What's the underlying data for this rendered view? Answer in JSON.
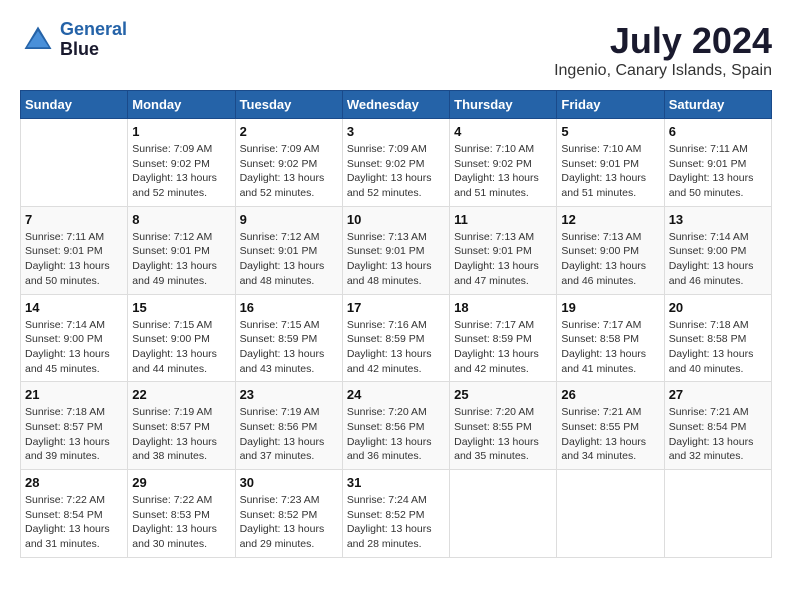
{
  "header": {
    "logo_line1": "General",
    "logo_line2": "Blue",
    "month_year": "July 2024",
    "location": "Ingenio, Canary Islands, Spain"
  },
  "columns": [
    "Sunday",
    "Monday",
    "Tuesday",
    "Wednesday",
    "Thursday",
    "Friday",
    "Saturday"
  ],
  "weeks": [
    [
      {
        "day": "",
        "info": ""
      },
      {
        "day": "1",
        "info": "Sunrise: 7:09 AM\nSunset: 9:02 PM\nDaylight: 13 hours\nand 52 minutes."
      },
      {
        "day": "2",
        "info": "Sunrise: 7:09 AM\nSunset: 9:02 PM\nDaylight: 13 hours\nand 52 minutes."
      },
      {
        "day": "3",
        "info": "Sunrise: 7:09 AM\nSunset: 9:02 PM\nDaylight: 13 hours\nand 52 minutes."
      },
      {
        "day": "4",
        "info": "Sunrise: 7:10 AM\nSunset: 9:02 PM\nDaylight: 13 hours\nand 51 minutes."
      },
      {
        "day": "5",
        "info": "Sunrise: 7:10 AM\nSunset: 9:01 PM\nDaylight: 13 hours\nand 51 minutes."
      },
      {
        "day": "6",
        "info": "Sunrise: 7:11 AM\nSunset: 9:01 PM\nDaylight: 13 hours\nand 50 minutes."
      }
    ],
    [
      {
        "day": "7",
        "info": "Sunrise: 7:11 AM\nSunset: 9:01 PM\nDaylight: 13 hours\nand 50 minutes."
      },
      {
        "day": "8",
        "info": "Sunrise: 7:12 AM\nSunset: 9:01 PM\nDaylight: 13 hours\nand 49 minutes."
      },
      {
        "day": "9",
        "info": "Sunrise: 7:12 AM\nSunset: 9:01 PM\nDaylight: 13 hours\nand 48 minutes."
      },
      {
        "day": "10",
        "info": "Sunrise: 7:13 AM\nSunset: 9:01 PM\nDaylight: 13 hours\nand 48 minutes."
      },
      {
        "day": "11",
        "info": "Sunrise: 7:13 AM\nSunset: 9:01 PM\nDaylight: 13 hours\nand 47 minutes."
      },
      {
        "day": "12",
        "info": "Sunrise: 7:13 AM\nSunset: 9:00 PM\nDaylight: 13 hours\nand 46 minutes."
      },
      {
        "day": "13",
        "info": "Sunrise: 7:14 AM\nSunset: 9:00 PM\nDaylight: 13 hours\nand 46 minutes."
      }
    ],
    [
      {
        "day": "14",
        "info": "Sunrise: 7:14 AM\nSunset: 9:00 PM\nDaylight: 13 hours\nand 45 minutes."
      },
      {
        "day": "15",
        "info": "Sunrise: 7:15 AM\nSunset: 9:00 PM\nDaylight: 13 hours\nand 44 minutes."
      },
      {
        "day": "16",
        "info": "Sunrise: 7:15 AM\nSunset: 8:59 PM\nDaylight: 13 hours\nand 43 minutes."
      },
      {
        "day": "17",
        "info": "Sunrise: 7:16 AM\nSunset: 8:59 PM\nDaylight: 13 hours\nand 42 minutes."
      },
      {
        "day": "18",
        "info": "Sunrise: 7:17 AM\nSunset: 8:59 PM\nDaylight: 13 hours\nand 42 minutes."
      },
      {
        "day": "19",
        "info": "Sunrise: 7:17 AM\nSunset: 8:58 PM\nDaylight: 13 hours\nand 41 minutes."
      },
      {
        "day": "20",
        "info": "Sunrise: 7:18 AM\nSunset: 8:58 PM\nDaylight: 13 hours\nand 40 minutes."
      }
    ],
    [
      {
        "day": "21",
        "info": "Sunrise: 7:18 AM\nSunset: 8:57 PM\nDaylight: 13 hours\nand 39 minutes."
      },
      {
        "day": "22",
        "info": "Sunrise: 7:19 AM\nSunset: 8:57 PM\nDaylight: 13 hours\nand 38 minutes."
      },
      {
        "day": "23",
        "info": "Sunrise: 7:19 AM\nSunset: 8:56 PM\nDaylight: 13 hours\nand 37 minutes."
      },
      {
        "day": "24",
        "info": "Sunrise: 7:20 AM\nSunset: 8:56 PM\nDaylight: 13 hours\nand 36 minutes."
      },
      {
        "day": "25",
        "info": "Sunrise: 7:20 AM\nSunset: 8:55 PM\nDaylight: 13 hours\nand 35 minutes."
      },
      {
        "day": "26",
        "info": "Sunrise: 7:21 AM\nSunset: 8:55 PM\nDaylight: 13 hours\nand 34 minutes."
      },
      {
        "day": "27",
        "info": "Sunrise: 7:21 AM\nSunset: 8:54 PM\nDaylight: 13 hours\nand 32 minutes."
      }
    ],
    [
      {
        "day": "28",
        "info": "Sunrise: 7:22 AM\nSunset: 8:54 PM\nDaylight: 13 hours\nand 31 minutes."
      },
      {
        "day": "29",
        "info": "Sunrise: 7:22 AM\nSunset: 8:53 PM\nDaylight: 13 hours\nand 30 minutes."
      },
      {
        "day": "30",
        "info": "Sunrise: 7:23 AM\nSunset: 8:52 PM\nDaylight: 13 hours\nand 29 minutes."
      },
      {
        "day": "31",
        "info": "Sunrise: 7:24 AM\nSunset: 8:52 PM\nDaylight: 13 hours\nand 28 minutes."
      },
      {
        "day": "",
        "info": ""
      },
      {
        "day": "",
        "info": ""
      },
      {
        "day": "",
        "info": ""
      }
    ]
  ]
}
